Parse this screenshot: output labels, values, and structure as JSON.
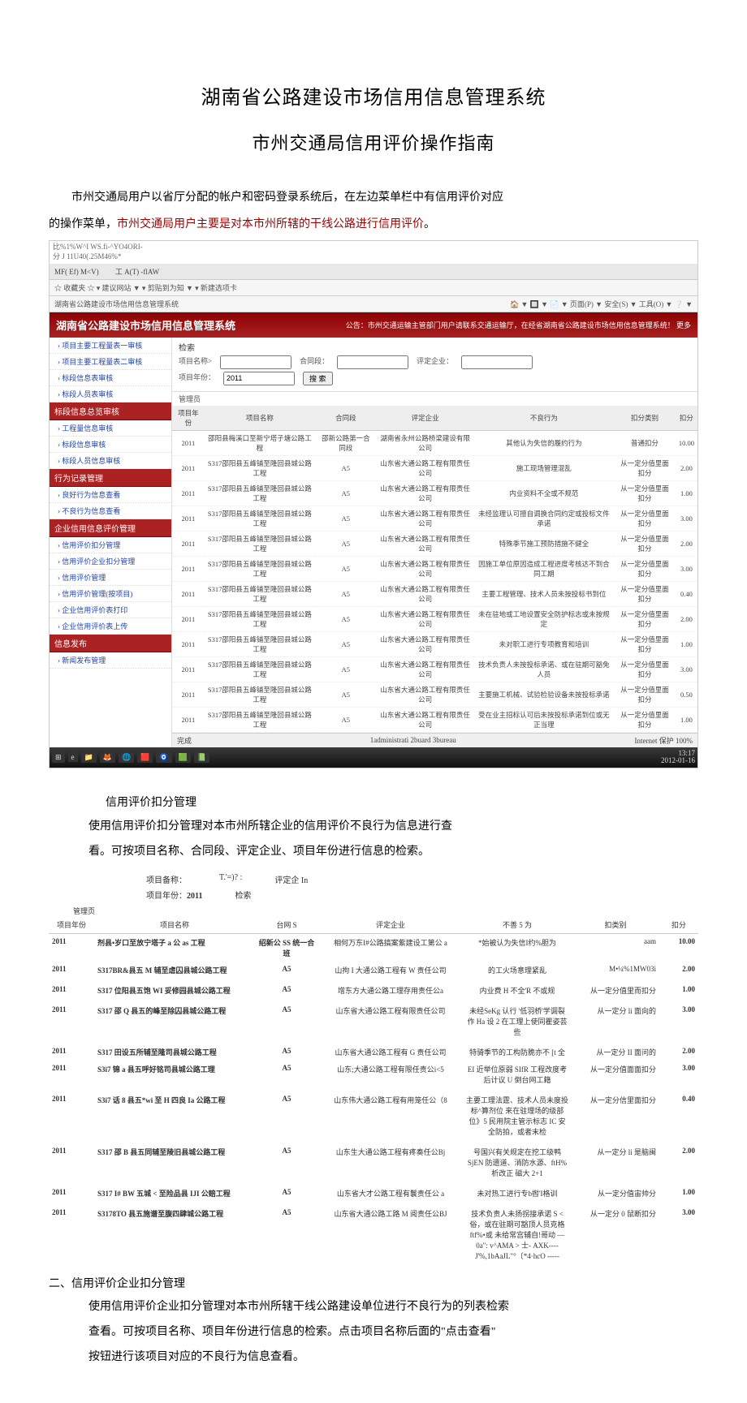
{
  "title_main": "湖南省公路建设市场信用信息管理系统",
  "title_sub": "市州交通局信用评价操作指南",
  "intro_line1_a": "市州交通局用户以省厅分配的帐户和密码登录系统后，在左边菜单栏中有信用评价对应",
  "intro_line2_a": "的操作菜单，",
  "intro_line2_b": "市州交通局用户主要是对本市州所辖的干线公路进行信用评价",
  "intro_line2_c": "。",
  "screenshot1": {
    "addr1": "比%1%W^I WS.fi-^YO4ORI-",
    "addr2": "分        J 11U40(.25M46%*",
    "tabs_left": "MF( Ef) M<V)",
    "tabs_right": "工 A(T) -flAW",
    "fav_left": "☆ 收藏夹   ☆ ▾ 建议网站 ▼ ▾ 剪贴到为知 ▼ ▾ 新建选项卡",
    "tab_title": "湖南省公路建设市场信用信息管理系统",
    "toolbar_right": "🏠 ▼ 🔲 ▼ 📄 ▼ 页面(P) ▼ 安全(S) ▼ 工具(O) ▼ ❔ ▼",
    "system_title": "湖南省公路建设市场信用信息管理系统",
    "notice": "公告：市州交通运输主管部门用户请联系交通运输厅，在经省湖南省公路建设市场信用信息管理系统！ 更多",
    "sidebar": [
      {
        "type": "item",
        "label": "› 项目主要工程量表一审核"
      },
      {
        "type": "item",
        "label": "› 项目主要工程量表二审核"
      },
      {
        "type": "item",
        "label": "› 标段信息表审核"
      },
      {
        "type": "item",
        "label": "› 标段人员表审核"
      },
      {
        "type": "group",
        "label": "标段信息总览审核"
      },
      {
        "type": "item",
        "label": "› 工程量信息审核"
      },
      {
        "type": "item",
        "label": "› 标段信息审核"
      },
      {
        "type": "item",
        "label": "› 标段人员信息审核"
      },
      {
        "type": "group",
        "label": "行为记录管理"
      },
      {
        "type": "item",
        "label": "› 良好行为信息查看"
      },
      {
        "type": "item",
        "label": "› 不良行为信息查看"
      },
      {
        "type": "group",
        "label": "企业信用信息评价管理"
      },
      {
        "type": "item",
        "label": "› 信用评价扣分管理"
      },
      {
        "type": "item",
        "label": "› 信用评价企业扣分管理"
      },
      {
        "type": "item",
        "label": "› 信用评价管理"
      },
      {
        "type": "item",
        "label": "› 信用评价管理(按项目)"
      },
      {
        "type": "item",
        "label": "› 企业信用评价表打印"
      },
      {
        "type": "item",
        "label": "› 企业信用评价表上传"
      },
      {
        "type": "group",
        "label": "信息发布"
      },
      {
        "type": "item",
        "label": "› 新闻发布管理"
      }
    ],
    "search": {
      "tab": "检索",
      "proj_name_label": "项目名称>",
      "seg_label": "合同段：",
      "ent_label": "评定企业：",
      "year_label": "项目年份：",
      "year_val": "2011",
      "btn": "搜 索"
    },
    "admin_label": "管理员",
    "columns": [
      "项目年份",
      "项目名称",
      "合同段",
      "评定企业",
      "不良行为",
      "扣分类别",
      "扣分"
    ],
    "rows": [
      [
        "2011",
        "邵阳县梅溪口至新宁塔子塘公路工程",
        "邵新公路第一合同段",
        "湖南省永州公路桥梁建设有限公司",
        "其他认为失信的履约行为",
        "普通扣分",
        "10.00"
      ],
      [
        "2011",
        "S317邵阳县五峰铺至隆回县城公路工程",
        "A5",
        "山东省大通公路工程有限责任公司",
        "施工现场管理混乱",
        "从一定分值里面扣分",
        "2.00"
      ],
      [
        "2011",
        "S317邵阳县五峰铺至隆回县城公路工程",
        "A5",
        "山东省大通公路工程有限责任公司",
        "内业资料不全或不规范",
        "从一定分值里面扣分",
        "1.00"
      ],
      [
        "2011",
        "S317邵阳县五峰铺至隆回县城公路工程",
        "A5",
        "山东省大通公路工程有限责任公司",
        "未经监理认可擅自调换合同约定或投标文件承诺",
        "从一定分值里面扣分",
        "3.00"
      ],
      [
        "2011",
        "S317邵阳县五峰铺至隆回县城公路工程",
        "A5",
        "山东省大通公路工程有限责任公司",
        "特殊季节施工预防措施不健全",
        "从一定分值里面扣分",
        "2.00"
      ],
      [
        "2011",
        "S317邵阳县五峰铺至隆回县城公路工程",
        "A5",
        "山东省大通公路工程有限责任公司",
        "因施工单位原因造成工程进度考核达不到合同工期",
        "从一定分值里面扣分",
        "3.00"
      ],
      [
        "2011",
        "S317邵阳县五峰铺至隆回县城公路工程",
        "A5",
        "山东省大通公路工程有限责任公司",
        "主要工程管理、技术人员未按投标书到位",
        "从一定分值里面扣分",
        "0.40"
      ],
      [
        "2011",
        "S317邵阳县五峰铺至隆回县城公路工程",
        "A5",
        "山东省大通公路工程有限责任公司",
        "未在驻地或工地设置安全防护标志或未按规定",
        "从一定分值里面扣分",
        "2.00"
      ],
      [
        "2011",
        "S317邵阳县五峰铺至隆回县城公路工程",
        "A5",
        "山东省大通公路工程有限责任公司",
        "未对职工进行专项教育和培训",
        "从一定分值里面扣分",
        "1.00"
      ],
      [
        "2011",
        "S317邵阳县五峰铺至隆回县城公路工程",
        "A5",
        "山东省大通公路工程有限责任公司",
        "技术负责人未按投标承诺、或在驻期可豁免人员",
        "从一定分值里面扣分",
        "3.00"
      ],
      [
        "2011",
        "S317邵阳县五峰铺至隆回县城公路工程",
        "A5",
        "山东省大通公路工程有限责任公司",
        "主要施工机械、试验检验设备未按投标承诺",
        "从一定分值里面扣分",
        "0.50"
      ],
      [
        "2011",
        "S317邵阳县五峰铺至隆回县城公路工程",
        "A5",
        "山东省大通公路工程有限责任公司",
        "受在业主招标认可后未按投标承诺到位或无正当理",
        "从一定分值里面扣分",
        "1.00"
      ]
    ],
    "footer_left": "完成",
    "footer_center": "1administrati 2buard 3bureau",
    "footer_right": "Internet 保护    100%",
    "taskbar": {
      "items": [
        "⊞",
        "e",
        "📁",
        "🦊",
        "🌐",
        "🟥",
        "🧿",
        "🟩",
        "📗"
      ],
      "clock": "13:17",
      "date": "2012-01-16"
    }
  },
  "section1_heading": "信用评价扣分管理",
  "section1_p1": "使用信用评价扣分管理对本市州所辖企业的信用评价不良行为信息进行查",
  "section1_p2": "看。可按项目名称、合同段、评定企业、项目年份进行信息的检索。",
  "search2": {
    "proj_label": "项目备称：",
    "seg_label": "T.'=)? :",
    "ent_label": "评定企 In",
    "year_label": "项目年份：",
    "year_val": "2011",
    "btn": "检索"
  },
  "mgr_label": "管理页",
  "table2_cols": [
    "项目年份",
    "项目名称",
    "台网 S",
    "评定企业",
    "不善 5 为",
    "扣类别",
    "扣分"
  ],
  "table2_rows": [
    {
      "y": "2011",
      "n": "剂县•岁口至放宁塔子 a 公 as 工程",
      "s": "绍新公 SS 统一合班",
      "e": "相何万东I#公路搞案紫建设工第公 a",
      "b": "*始被认为失信I约%胆为",
      "c": "aam",
      "k": "10.00"
    },
    {
      "y": "2011",
      "n": "S317BR&县五 M 辅至虐囚县城公路工程",
      "s": "A5",
      "e": "山拘 I 大通公路工程有 W 责任公司",
      "b": "的工火场意理紧乱",
      "c": "M•¼%1MW03i",
      "k": "2.00"
    },
    {
      "y": "2011",
      "n": "S317 位阳县五饱 WI 妥修园县城公路工程",
      "s": "A5",
      "e": "增东方大通公路工理存用责任公a",
      "b": "内业费 H 不全'R 不或规",
      "c": "从一定分值里而扣分",
      "k": "1.00",
      "gap": true
    },
    {
      "y": "2011",
      "n": "S317 邵 Q 县五的峰至除囚县城公路工程",
      "s": "A5",
      "e": "山东省大通公路工程有限责任公司",
      "b": "未经SeKg 认行 '低羽桥'学调裂作 Ha 设 2 在工理上使同瞿姿芸 些",
      "c": "从一定分 li 面向的",
      "k": "3.00",
      "gap": true
    },
    {
      "y": "2011",
      "n": "S317 田设五所辅至隆司县城公路工程",
      "s": "A5",
      "e": "山东省大通公路工程有 G 责任公司",
      "b": "特骑季节的工构防脆亦不 [t 全",
      "c": "从一定分 II 面问的",
      "k": "2.00",
      "gap": true
    },
    {
      "y": "2011",
      "n": "S3i7 锦 a 县五呼好铭司县城公路工理",
      "s": "A5",
      "e": "山东;大通公路工程有限任责公i<5",
      "b": "EI 近举位原弱 SIfR 工程改度考后计议 U 倒台网工籍",
      "c": "从一定分值面面扣分",
      "k": "3.00"
    },
    {
      "y": "2011",
      "n": "S3i7 话 8 县五*wi 至 H 四良 Ia 公路工程",
      "s": "A5",
      "e": "山东伟大通公路工程有用笼任公（8",
      "b": "主要工理法霆、技术人员未度投标^算剂位 来在驻理场的级部位》5 民用院主管示标志 IC 安全防拍，或者末检",
      "c": "从一定分信里面扣分",
      "k": "0.40",
      "gap": true
    },
    {
      "y": "2011",
      "n": "S317 邵 B 县五同辅至陵旧县城公路工程",
      "s": "A5",
      "e": "山东生大通公路工程有疼奏任公Bj",
      "b": "号国兴有关规定在挖工级鸭 SjEN 防遗道、消防水源、ftH%析改正 磁大 2+1",
      "c": "从一定分 li 是脑闽",
      "k": "2.00",
      "gap": true
    },
    {
      "y": "2011",
      "n": "S317 I# BW 五城 < 至险品县 IJI 公赔工程",
      "s": "A5",
      "e": "山东省大才公路工程有鬟责任公 a",
      "b": "未对热工进行专b辔'I格训",
      "c": "从一定分值宙帅分",
      "k": "1.00",
      "gap": true
    },
    {
      "y": "2011",
      "n": "S3178TO 县五施谱至腹四肆城公路工程",
      "s": "A5",
      "e": "山东省大通公路工路 M 阅责任公BJ",
      "b": "技术负责人未扬拐接承诺 S < 俗，或在驻期可豁顶人员克格 ftf%•或 未给常宫辅自!哥动 — 0a\": v^AMA > 士- AXK----J'%,1bAaJL\"°〔*4·hcO -----",
      "c": "从一定分 0 鼠断扣分",
      "k": "3.00",
      "gap": true
    }
  ],
  "section2_head": "二、信用评价企业扣分管理",
  "section2_p1": "使用信用评价企业扣分管理对本市州所辖干线公路建设单位进行不良行为的列表检索",
  "section2_p2": "查看。可按项目名称、项目年份进行信息的检索。点击项目名称后面的\"点击查看\"",
  "section2_p3": "按钮进行该项目对应的不良行为信息查看。"
}
